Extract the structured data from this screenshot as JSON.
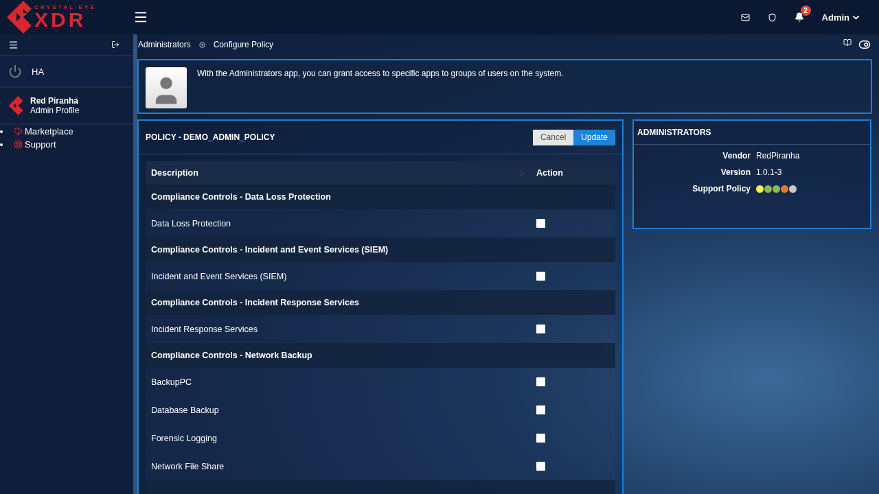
{
  "brand": {
    "tagline": "CRYSTAL EYE",
    "name": "XDR"
  },
  "topbar": {
    "notifications": "2",
    "user": "Admin"
  },
  "sidebar": {
    "status": "HA",
    "profile": {
      "name": "Red Piranha",
      "role": "Admin Profile"
    },
    "links": [
      {
        "label": "Marketplace",
        "kind": "download"
      },
      {
        "label": "Support",
        "kind": "support"
      }
    ]
  },
  "breadcrumb": [
    "Administrators",
    "Configure Policy"
  ],
  "intro": "With the Administrators app, you can grant access to specific apps to groups of users on the system.",
  "policy": {
    "title": "POLICY - DEMO_ADMIN_POLICY",
    "buttons": [
      {
        "label": "Cancel",
        "kind": "secondary"
      },
      {
        "label": "Update",
        "kind": "primary"
      }
    ],
    "columns": [
      "Description",
      "Action"
    ],
    "rows": [
      {
        "kind": "group",
        "label": "Compliance Controls - Data Loss Protection"
      },
      {
        "kind": "item",
        "label": "Data Loss Protection",
        "checked": false
      },
      {
        "kind": "group",
        "label": "Compliance Controls - Incident and Event Services (SIEM)"
      },
      {
        "kind": "item",
        "label": "Incident and Event Services (SIEM)",
        "checked": false
      },
      {
        "kind": "group",
        "label": "Compliance Controls - Incident Response Services"
      },
      {
        "kind": "item",
        "label": "Incident Response Services",
        "checked": false
      },
      {
        "kind": "group",
        "label": "Compliance Controls - Network Backup"
      },
      {
        "kind": "item",
        "label": "BackupPC",
        "checked": false
      },
      {
        "kind": "item",
        "label": "Database Backup",
        "checked": false
      },
      {
        "kind": "item",
        "label": "Forensic Logging",
        "checked": false
      },
      {
        "kind": "item",
        "label": "Network File Share",
        "checked": false
      }
    ]
  },
  "app_info": {
    "title": "ADMINISTRATORS",
    "fields": [
      {
        "kind": "text",
        "label": "Vendor",
        "value": "RedPiranha"
      },
      {
        "kind": "text",
        "label": "Version",
        "value": "1.0.1-3"
      },
      {
        "kind": "dots",
        "label": "Support Policy",
        "dots": [
          {
            "color": "#f2ee4c"
          },
          {
            "color": "#8db84a"
          },
          {
            "color": "#8db84a"
          },
          {
            "color": "#e07a2a"
          },
          {
            "color": "#c8c8c8"
          }
        ]
      }
    ]
  }
}
